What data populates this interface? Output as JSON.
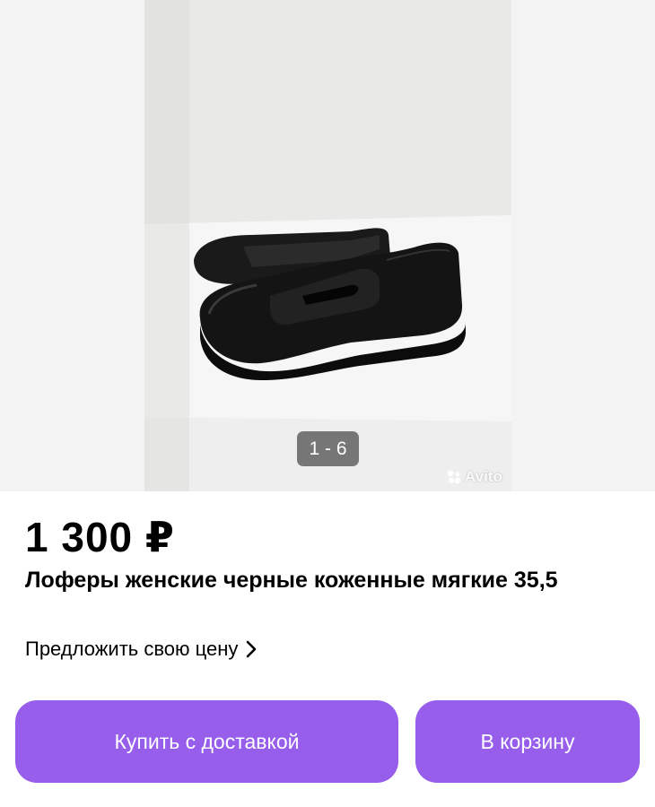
{
  "gallery": {
    "counter": "1 - 6",
    "watermark": "Avito",
    "image_alt": "black-loafer-photo"
  },
  "listing": {
    "price": "1 300 ₽",
    "title": "Лоферы женские черные коженные мягкие 35,5",
    "offer_label": "Предложить свою цену"
  },
  "actions": {
    "buy_label": "Купить с доставкой",
    "cart_label": "В корзину"
  },
  "colors": {
    "accent": "#965eeb",
    "counter_bg": "#555555"
  },
  "icons": {
    "offer_arrow": "chevron-right-icon",
    "watermark_logo": "avito-logo-icon"
  }
}
